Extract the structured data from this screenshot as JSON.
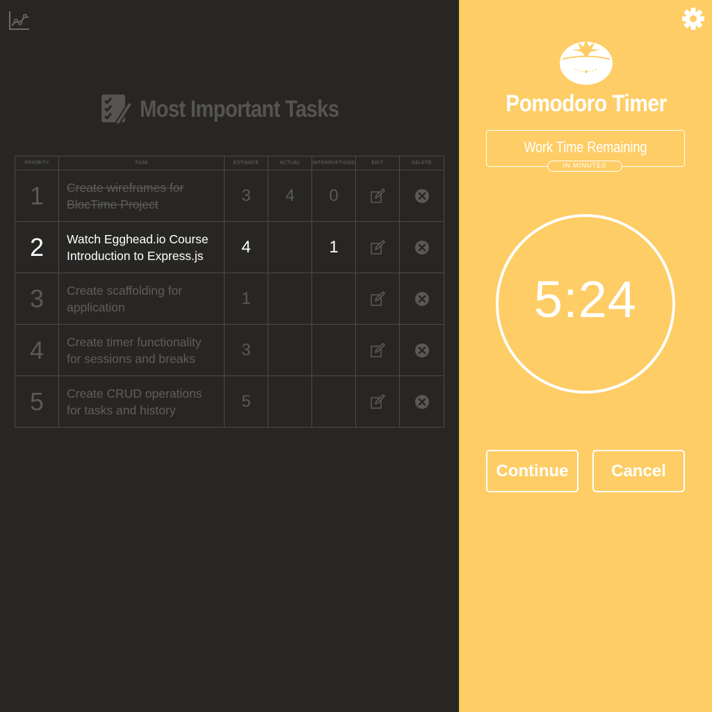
{
  "left": {
    "title": "Most Important Tasks",
    "table": {
      "headers": [
        "PRIORITY",
        "TASK",
        "ESTIMATE",
        "ACTUAL",
        "INTERRUPTIONS",
        "EDIT",
        "DELETE"
      ],
      "rows": [
        {
          "priority": "1",
          "task": "Create wireframes for BlocTime Project",
          "estimate": "3",
          "actual": "4",
          "interruptions": "0",
          "status": "done"
        },
        {
          "priority": "2",
          "task": "Watch Egghead.io Course Introduction to Express.js",
          "estimate": "4",
          "actual": "",
          "interruptions": "1",
          "status": "active"
        },
        {
          "priority": "3",
          "task": "Create scaffolding for application",
          "estimate": "1",
          "actual": "",
          "interruptions": "",
          "status": "pending"
        },
        {
          "priority": "4",
          "task": "Create timer functionality for sessions and breaks",
          "estimate": "3",
          "actual": "",
          "interruptions": "",
          "status": "pending"
        },
        {
          "priority": "5",
          "task": "Create CRUD operations for tasks and history",
          "estimate": "5",
          "actual": "",
          "interruptions": "",
          "status": "pending"
        }
      ]
    },
    "icons": {
      "chart": "line-chart-icon",
      "title": "checklist-pencil-icon",
      "edit": "edit-icon",
      "delete": "close-circle-icon"
    }
  },
  "right": {
    "title": "Pomodoro Timer",
    "mode_label": "Work Time Remaining",
    "mode_unit": "IN MINUTES",
    "time": "5:24",
    "continue_label": "Continue",
    "cancel_label": "Cancel",
    "icons": {
      "settings": "gear-icon",
      "logo": "tomato-icon"
    }
  },
  "colors": {
    "left_bg": "#272624",
    "right_bg": "#fecd66",
    "muted_text": "#5f5e5c",
    "active_text": "#ffffff"
  }
}
